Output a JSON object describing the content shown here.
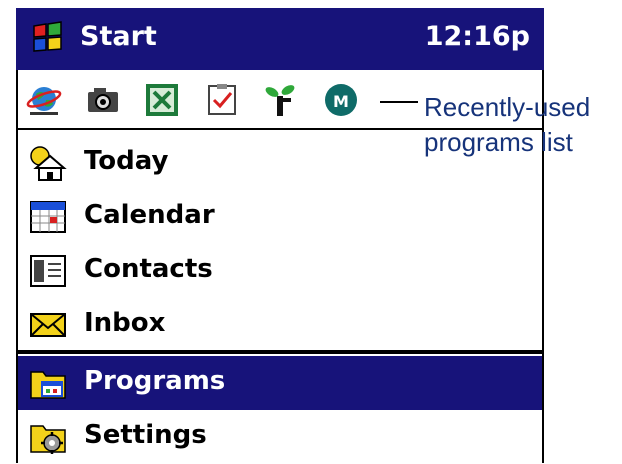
{
  "titlebar": {
    "title": "Start",
    "clock": "12:16p"
  },
  "recent_programs": [
    {
      "icon": "internet-explorer-icon"
    },
    {
      "icon": "camera-icon"
    },
    {
      "icon": "excel-icon"
    },
    {
      "icon": "tasks-icon"
    },
    {
      "icon": "plant-app-icon"
    },
    {
      "icon": "msn-messenger-icon"
    }
  ],
  "menu": {
    "items": [
      {
        "label": "Today",
        "icon": "today-house-icon"
      },
      {
        "label": "Calendar",
        "icon": "calendar-icon"
      },
      {
        "label": "Contacts",
        "icon": "contacts-card-icon"
      },
      {
        "label": "Inbox",
        "icon": "envelope-icon"
      }
    ],
    "folders": [
      {
        "label": "Programs",
        "icon": "programs-folder-icon",
        "selected": true
      },
      {
        "label": "Settings",
        "icon": "settings-folder-icon",
        "selected": false
      }
    ]
  },
  "annotation": {
    "line1": "Recently-used",
    "line2": "programs list"
  },
  "colors": {
    "titlebar": "#17137a",
    "selection": "#17137a",
    "annotation_text": "#16337a"
  }
}
